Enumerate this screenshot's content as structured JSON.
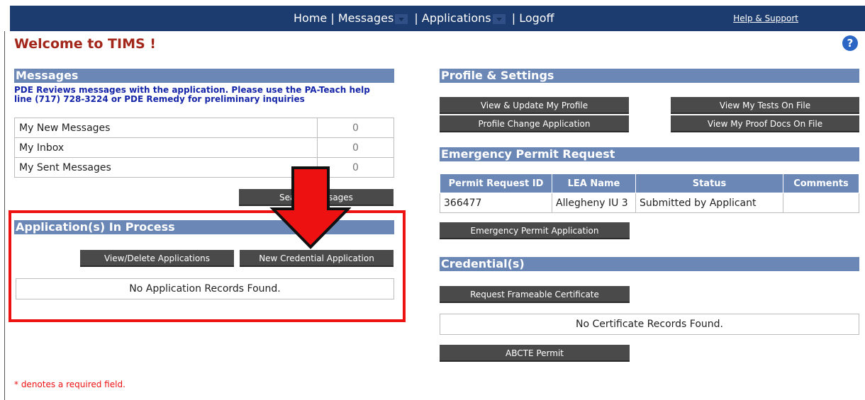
{
  "nav": {
    "home": "Home",
    "sep": "|",
    "messages": "Messages",
    "applications": "Applications",
    "logoff": "Logoff",
    "help": "Help & Support"
  },
  "welcome": "Welcome to TIMS !",
  "messages": {
    "title": "Messages",
    "note": "PDE Reviews messages with the application. Please use the PA-Teach help line (717) 728-3224 or PDE Remedy for preliminary inquiries",
    "rows": [
      {
        "label": "My New Messages",
        "count": "0"
      },
      {
        "label": "My Inbox",
        "count": "0"
      },
      {
        "label": "My Sent Messages",
        "count": "0"
      }
    ],
    "search_button": "Search Messages"
  },
  "applications": {
    "title": "Application(s) In Process",
    "view_delete": "View/Delete Applications",
    "new_credential": "New Credential Application",
    "empty": "No Application Records Found."
  },
  "profile": {
    "title": "Profile & Settings",
    "view_update": "View & Update My Profile",
    "change_app": "Profile Change Application",
    "tests": "View My Tests On File",
    "proof_docs": "View My Proof Docs On File"
  },
  "permit": {
    "title": "Emergency Permit Request",
    "headers": [
      "Permit Request ID",
      "LEA Name",
      "Status",
      "Comments"
    ],
    "rows": [
      {
        "id": "366477",
        "lea": "Allegheny IU 3",
        "status": "Submitted by Applicant",
        "comments": ""
      }
    ],
    "button": "Emergency Permit Application"
  },
  "credentials": {
    "title": "Credential(s)",
    "frameable": "Request Frameable Certificate",
    "empty": "No Certificate Records Found.",
    "abcte": "ABCTE Permit"
  },
  "footer_note": "* denotes a required field.",
  "colors": {
    "navbar": "#1c3b6e",
    "section_header": "#6b87b6",
    "welcome_text": "#a3261a",
    "highlight": "#ee1111"
  }
}
